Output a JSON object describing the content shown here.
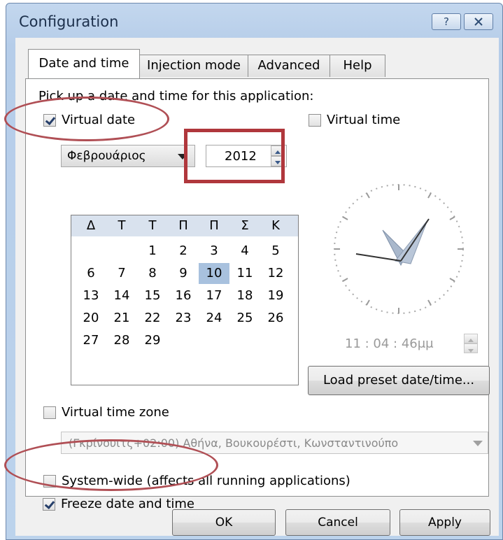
{
  "window": {
    "title": "Configuration",
    "help_button": "?",
    "close_button": "⊠"
  },
  "tabs": [
    {
      "label": "Date and time",
      "active": true
    },
    {
      "label": "Injection mode",
      "active": false
    },
    {
      "label": "Advanced",
      "active": false
    },
    {
      "label": "Help",
      "active": false
    }
  ],
  "panel": {
    "instruction": "Pick up a date and time for this application:",
    "virtual_date": {
      "label": "Virtual date",
      "checked": true
    },
    "virtual_time": {
      "label": "Virtual time",
      "checked": false
    },
    "month_select": {
      "value": "Φεβρουάριος"
    },
    "year_spinner": {
      "value": "2012"
    },
    "calendar": {
      "weekdays": [
        "Δ",
        "Τ",
        "Τ",
        "Π",
        "Π",
        "Σ",
        "Κ"
      ],
      "weeks": [
        [
          "",
          "",
          "1",
          "2",
          "3",
          "4",
          "5"
        ],
        [
          "6",
          "7",
          "8",
          "9",
          "10",
          "11",
          "12"
        ],
        [
          "13",
          "14",
          "15",
          "16",
          "17",
          "18",
          "19"
        ],
        [
          "20",
          "21",
          "22",
          "23",
          "24",
          "25",
          "26"
        ],
        [
          "27",
          "28",
          "29",
          "",
          "",
          "",
          ""
        ]
      ],
      "selected_day": "10"
    },
    "time_display": "11 : 04 : 46μμ",
    "load_preset_button": "Load preset date/time...",
    "virtual_time_zone": {
      "label": "Virtual time zone",
      "checked": false
    },
    "time_zone_select": {
      "value": "(Γκρίνουιτς+02:00) Αθήνα, Βουκουρέστι, Κωνσταντινούπο"
    },
    "system_wide": {
      "label": "System-wide (affects all running applications)",
      "checked": false
    },
    "freeze": {
      "label": "Freeze date and time",
      "checked": true
    }
  },
  "buttons": {
    "ok": "OK",
    "cancel": "Cancel",
    "apply": "Apply"
  },
  "colors": {
    "annotation_red": "#b0373c",
    "selection_blue": "#a8c1de",
    "title_bar": "#c3d7ee"
  }
}
